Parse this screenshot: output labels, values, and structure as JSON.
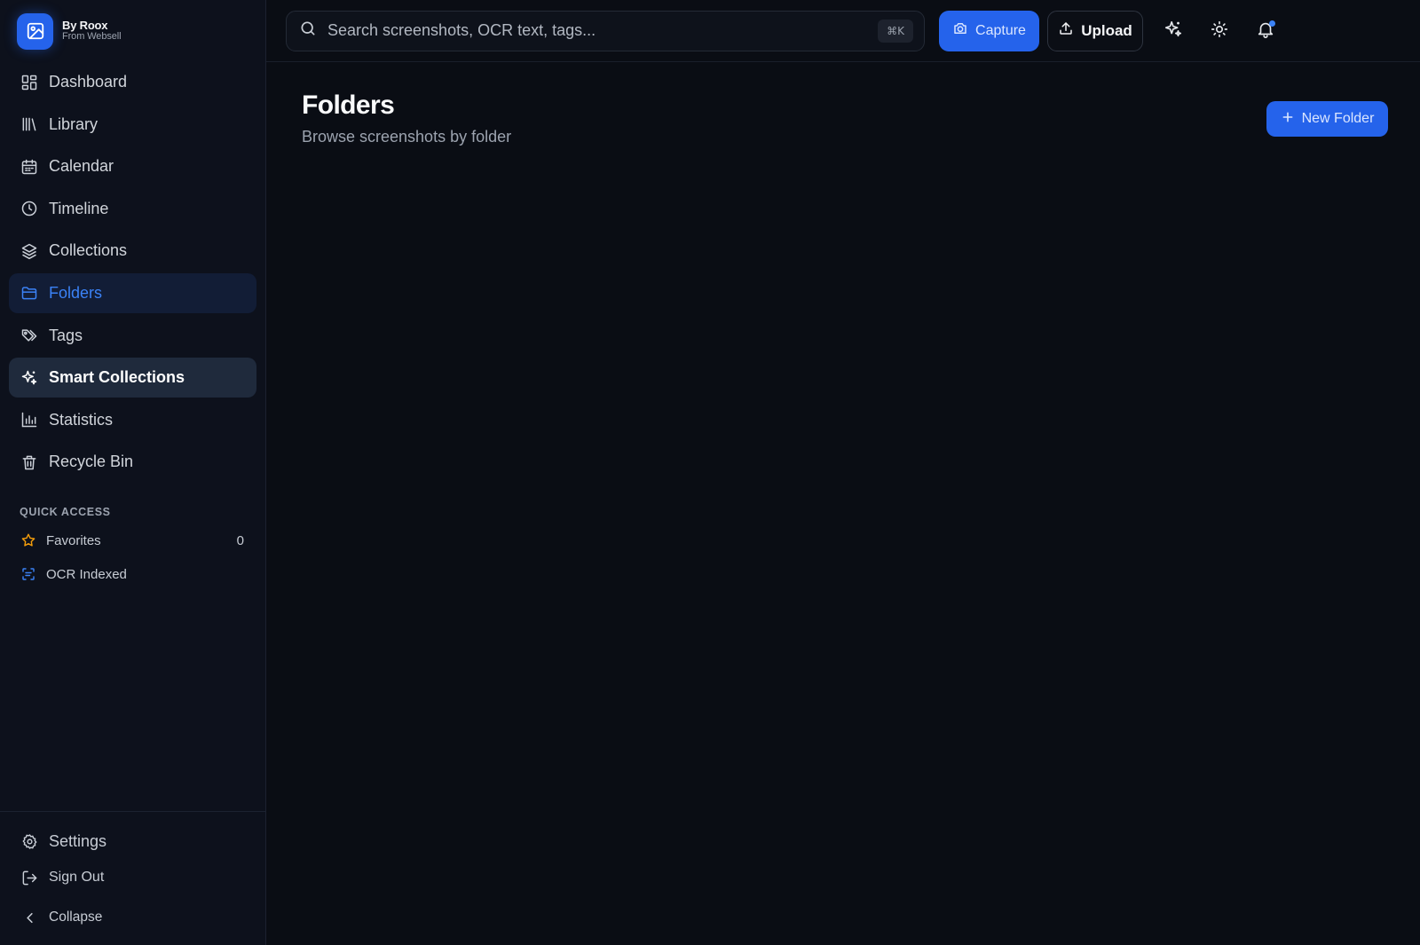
{
  "brand": {
    "name": "By Roox",
    "subtitle": "From Websell",
    "logo_icon": "image-icon",
    "accent": "#2563eb"
  },
  "sidebar": {
    "items": [
      {
        "label": "Dashboard",
        "icon": "dashboard-icon"
      },
      {
        "label": "Library",
        "icon": "library-icon"
      },
      {
        "label": "Calendar",
        "icon": "calendar-icon"
      },
      {
        "label": "Timeline",
        "icon": "clock-icon"
      },
      {
        "label": "Collections",
        "icon": "layers-icon"
      },
      {
        "label": "Folders",
        "icon": "folder-icon",
        "state": "active"
      },
      {
        "label": "Tags",
        "icon": "tags-icon"
      },
      {
        "label": "Smart Collections",
        "icon": "sparkles-icon",
        "state": "highlighted"
      },
      {
        "label": "Statistics",
        "icon": "bar-chart-icon"
      },
      {
        "label": "Recycle Bin",
        "icon": "trash-icon"
      }
    ],
    "quick_access": {
      "title": "QUICK ACCESS",
      "items": [
        {
          "label": "Favorites",
          "icon": "star-icon",
          "count": "0",
          "color": "#f59e0b"
        },
        {
          "label": "OCR Indexed",
          "icon": "scan-text-icon",
          "color": "#3b82f6"
        }
      ]
    },
    "footer": {
      "settings": "Settings",
      "sign_out": "Sign Out",
      "collapse": "Collapse"
    }
  },
  "topbar": {
    "search_placeholder": "Search screenshots, OCR text, tags...",
    "shortcut": "⌘K",
    "capture_label": "Capture",
    "upload_label": "Upload",
    "icons": [
      "sparkles-icon",
      "sun-icon",
      "bell-icon"
    ]
  },
  "main": {
    "title": "Folders",
    "subtitle": "Browse screenshots by folder",
    "new_folder_label": "New Folder"
  },
  "colors": {
    "background": "#0a0d14",
    "sidebar": "#0d111c",
    "active_bg": "#121d36",
    "active_text": "#3b82f6",
    "highlight_bg": "#1f2a3c",
    "primary": "#2563eb"
  }
}
